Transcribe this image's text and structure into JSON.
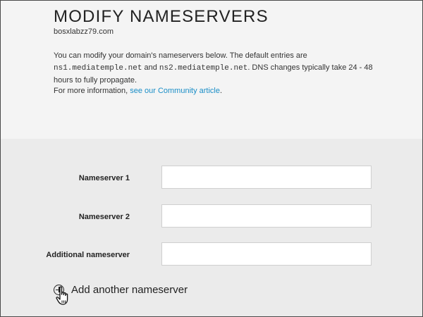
{
  "header": {
    "title": "MODIFY NAMESERVERS",
    "domain": "bosxlabzz79.com",
    "description_part1": "You can modify your domain's nameservers below. The default entries are ",
    "default_ns1": "ns1.mediatemple.net",
    "description_part2": " and ",
    "default_ns2": "ns2.mediatemple.net",
    "description_part3": ". DNS changes typically take 24 - 48 hours to fully propagate.",
    "info_prefix": "For more information, ",
    "info_link": "see our Community article",
    "info_suffix": "."
  },
  "form": {
    "ns1_label": "Nameserver 1",
    "ns1_value": "",
    "ns2_label": "Nameserver 2",
    "ns2_value": "",
    "additional_label": "Additional nameserver",
    "additional_value": "",
    "add_label": "Add another nameserver"
  },
  "icons": {
    "add": "plus-circle-icon",
    "cursor": "hand-pointer-icon"
  },
  "colors": {
    "link": "#1a8ec7",
    "header_bg": "#f4f4f4",
    "form_bg": "#ebebeb"
  }
}
